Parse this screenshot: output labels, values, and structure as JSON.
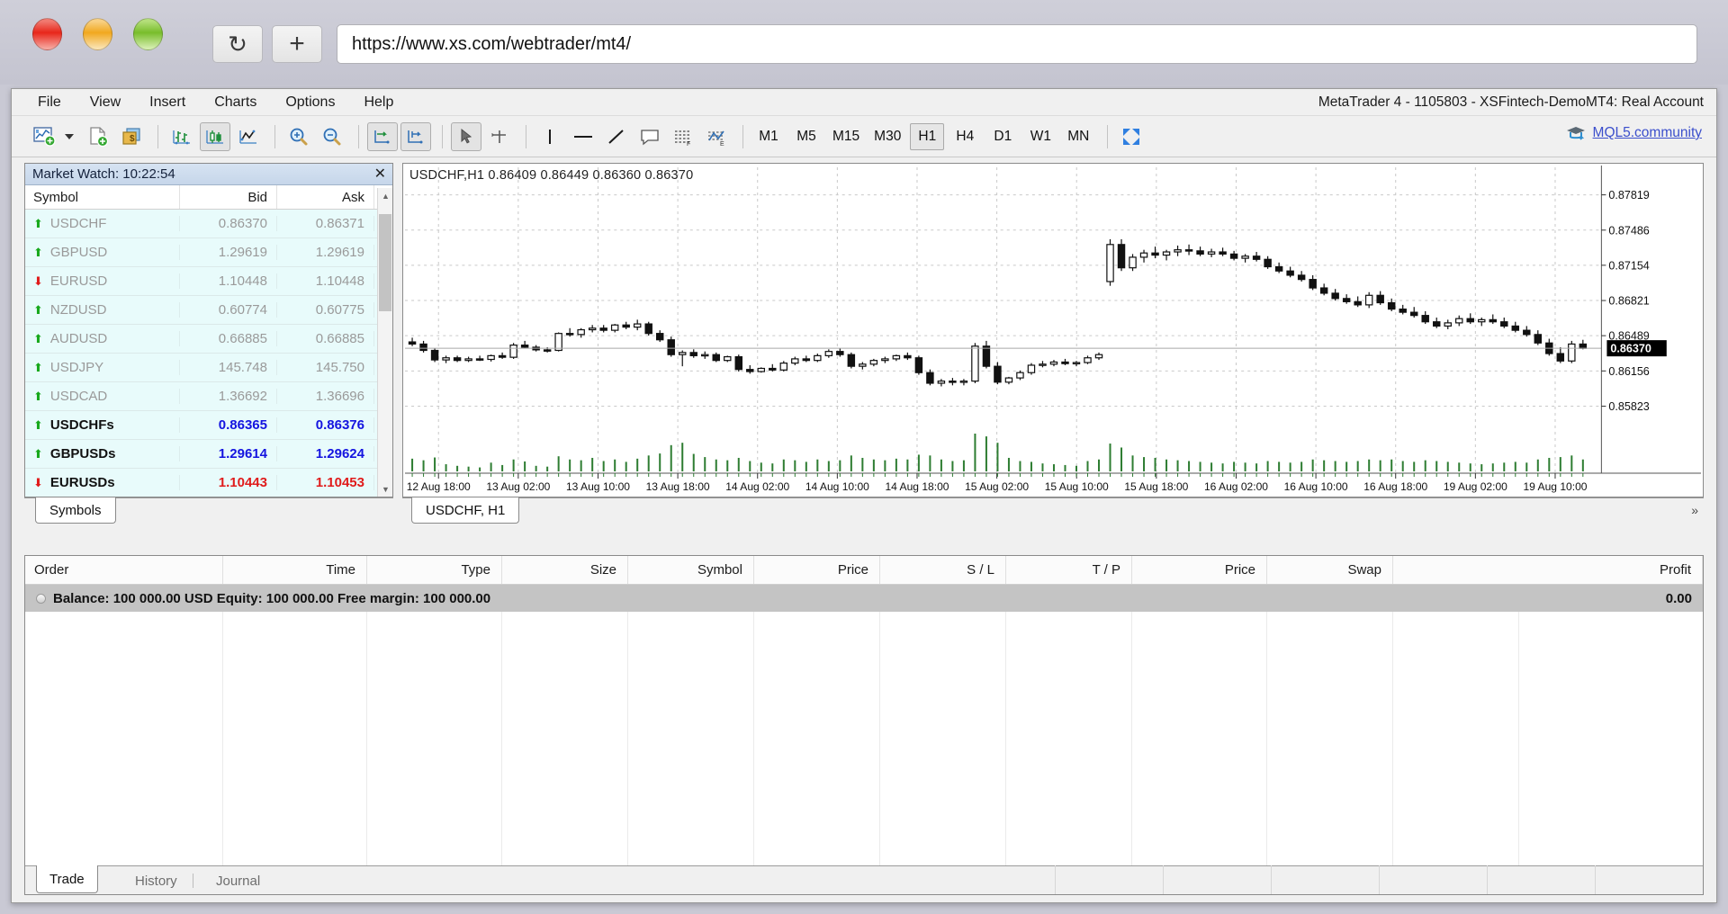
{
  "browser": {
    "url": "https://www.xs.com/webtrader/mt4/",
    "reload_icon": "reload-icon",
    "newtab_icon": "plus-icon",
    "traffic_lights": [
      "close",
      "minimize",
      "maximize"
    ]
  },
  "app": {
    "account_info": "MetaTrader 4 - 1105803 - XSFintech-DemoMT4: Real Account",
    "menu": [
      "File",
      "View",
      "Insert",
      "Charts",
      "Options",
      "Help"
    ],
    "mql5_link": "MQL5.community"
  },
  "toolbar": {
    "timeframes": [
      {
        "label": "M1",
        "active": false
      },
      {
        "label": "M5",
        "active": false
      },
      {
        "label": "M15",
        "active": false
      },
      {
        "label": "M30",
        "active": false
      },
      {
        "label": "H1",
        "active": true
      },
      {
        "label": "H4",
        "active": false
      },
      {
        "label": "D1",
        "active": false
      },
      {
        "label": "W1",
        "active": false
      },
      {
        "label": "MN",
        "active": false
      }
    ],
    "icons": [
      "new-chart-icon",
      "new-order-icon",
      "accounts-icon",
      "bar-chart-icon",
      "candlestick-chart-icon",
      "line-chart-icon",
      "zoom-in-icon",
      "zoom-out-icon",
      "auto-scroll-icon",
      "chart-shift-icon",
      "cursor-icon",
      "crosshair-icon",
      "vertical-line-icon",
      "horizontal-line-icon",
      "trendline-icon",
      "text-label-icon",
      "fibonacci-icon",
      "indicators-icon",
      "fullscreen-icon"
    ]
  },
  "market_watch": {
    "title": "Market Watch: 10:22:54",
    "close_icon": "close-icon",
    "columns": [
      "Symbol",
      "Bid",
      "Ask"
    ],
    "tab": "Symbols",
    "rows": [
      {
        "dir": "up",
        "symbol": "USDCHF",
        "bid": "0.86370",
        "ask": "0.86371",
        "style": "dim"
      },
      {
        "dir": "up",
        "symbol": "GBPUSD",
        "bid": "1.29619",
        "ask": "1.29619",
        "style": "dim"
      },
      {
        "dir": "down",
        "symbol": "EURUSD",
        "bid": "1.10448",
        "ask": "1.10448",
        "style": "dim"
      },
      {
        "dir": "up",
        "symbol": "NZDUSD",
        "bid": "0.60774",
        "ask": "0.60775",
        "style": "dim"
      },
      {
        "dir": "up",
        "symbol": "AUDUSD",
        "bid": "0.66885",
        "ask": "0.66885",
        "style": "dim"
      },
      {
        "dir": "up",
        "symbol": "USDJPY",
        "bid": "145.748",
        "ask": "145.750",
        "style": "dim"
      },
      {
        "dir": "up",
        "symbol": "USDCAD",
        "bid": "1.36692",
        "ask": "1.36696",
        "style": "dim"
      },
      {
        "dir": "up",
        "symbol": "USDCHFs",
        "bid": "0.86365",
        "ask": "0.86376",
        "style": "blue"
      },
      {
        "dir": "up",
        "symbol": "GBPUSDs",
        "bid": "1.29614",
        "ask": "1.29624",
        "style": "blue"
      },
      {
        "dir": "down",
        "symbol": "EURUSDs",
        "bid": "1.10443",
        "ask": "1.10453",
        "style": "red"
      }
    ]
  },
  "chart": {
    "header": "USDCHF,H1  0.86409 0.86449 0.86360 0.86370",
    "tab_label": "USDCHF, H1",
    "more_icon": "chevron-right-icon",
    "current_price": "0.86370"
  },
  "terminal": {
    "columns": [
      "Order",
      "Time",
      "Type",
      "Size",
      "Symbol",
      "Price",
      "S / L",
      "T / P",
      "Price",
      "Swap",
      "Profit"
    ],
    "balance_line": "Balance: 100 000.00 USD  Equity: 100 000.00  Free margin: 100 000.00",
    "profit_value": "0.00",
    "tabs": [
      {
        "label": "Trade",
        "active": true
      },
      {
        "label": "History",
        "active": false
      },
      {
        "label": "Journal",
        "active": false
      }
    ]
  },
  "chart_data": {
    "type": "candlestick",
    "title": "USDCHF,H1",
    "symbol": "USDCHF",
    "timeframe": "H1",
    "ohlc_last": {
      "open": "0.86409",
      "high": "0.86449",
      "low": "0.86360",
      "close": "0.86370"
    },
    "y_ticks": [
      "0.87819",
      "0.87486",
      "0.87154",
      "0.86821",
      "0.86489",
      "0.86156",
      "0.85823"
    ],
    "ylim": [
      0.857,
      0.8796
    ],
    "price_line": 0.8637,
    "x_ticks": [
      "12 Aug 18:00",
      "13 Aug 02:00",
      "13 Aug 10:00",
      "13 Aug 18:00",
      "14 Aug 02:00",
      "14 Aug 10:00",
      "14 Aug 18:00",
      "15 Aug 02:00",
      "15 Aug 10:00",
      "15 Aug 18:00",
      "16 Aug 02:00",
      "16 Aug 10:00",
      "16 Aug 18:00",
      "19 Aug 02:00",
      "19 Aug 10:00"
    ],
    "grid": true,
    "volume_color": "#2e7d32",
    "candles": [
      [
        0.8643,
        0.8647,
        0.8639,
        0.8641,
        32
      ],
      [
        0.8641,
        0.8644,
        0.8633,
        0.8635,
        28
      ],
      [
        0.8635,
        0.8637,
        0.8624,
        0.8626,
        35
      ],
      [
        0.8626,
        0.863,
        0.8623,
        0.8628,
        18
      ],
      [
        0.8628,
        0.863,
        0.8624,
        0.86255,
        14
      ],
      [
        0.86255,
        0.8629,
        0.8624,
        0.8627,
        12
      ],
      [
        0.8627,
        0.863,
        0.8625,
        0.86265,
        10
      ],
      [
        0.86265,
        0.8631,
        0.86245,
        0.863,
        22
      ],
      [
        0.863,
        0.8633,
        0.8627,
        0.86285,
        16
      ],
      [
        0.86285,
        0.8642,
        0.8627,
        0.864,
        30
      ],
      [
        0.864,
        0.8644,
        0.8637,
        0.8638,
        25
      ],
      [
        0.8638,
        0.864,
        0.8634,
        0.86355,
        14
      ],
      [
        0.86355,
        0.8638,
        0.8633,
        0.8635,
        12
      ],
      [
        0.8635,
        0.8652,
        0.8634,
        0.8651,
        38
      ],
      [
        0.8651,
        0.8656,
        0.8648,
        0.865,
        30
      ],
      [
        0.865,
        0.8656,
        0.8647,
        0.86545,
        28
      ],
      [
        0.86545,
        0.8659,
        0.8652,
        0.8656,
        34
      ],
      [
        0.8656,
        0.8659,
        0.8652,
        0.8654,
        26
      ],
      [
        0.8654,
        0.866,
        0.8652,
        0.8659,
        30
      ],
      [
        0.8659,
        0.8662,
        0.8655,
        0.8657,
        24
      ],
      [
        0.8657,
        0.8664,
        0.8654,
        0.866,
        32
      ],
      [
        0.866,
        0.8662,
        0.8649,
        0.8651,
        40
      ],
      [
        0.8651,
        0.8654,
        0.8643,
        0.8645,
        45
      ],
      [
        0.8645,
        0.8648,
        0.8629,
        0.8631,
        66
      ],
      [
        0.8631,
        0.8635,
        0.862,
        0.8633,
        72
      ],
      [
        0.8633,
        0.8636,
        0.8628,
        0.863,
        44
      ],
      [
        0.863,
        0.8634,
        0.8627,
        0.8631,
        36
      ],
      [
        0.8631,
        0.8633,
        0.8624,
        0.86255,
        30
      ],
      [
        0.86255,
        0.863,
        0.8624,
        0.8629,
        28
      ],
      [
        0.8629,
        0.8631,
        0.8615,
        0.8617,
        34
      ],
      [
        0.8617,
        0.8621,
        0.8613,
        0.8615,
        26
      ],
      [
        0.8615,
        0.8619,
        0.8614,
        0.8618,
        22
      ],
      [
        0.8618,
        0.8622,
        0.8615,
        0.86165,
        20
      ],
      [
        0.86165,
        0.8625,
        0.8615,
        0.8623,
        30
      ],
      [
        0.8623,
        0.8629,
        0.8621,
        0.8627,
        28
      ],
      [
        0.8627,
        0.863,
        0.8624,
        0.86255,
        24
      ],
      [
        0.86255,
        0.8632,
        0.8624,
        0.863,
        30
      ],
      [
        0.863,
        0.8636,
        0.8628,
        0.8634,
        26
      ],
      [
        0.8634,
        0.8637,
        0.8629,
        0.8631,
        28
      ],
      [
        0.8631,
        0.8633,
        0.8618,
        0.862,
        40
      ],
      [
        0.862,
        0.8624,
        0.8617,
        0.8622,
        34
      ],
      [
        0.8622,
        0.8627,
        0.862,
        0.86255,
        30
      ],
      [
        0.86255,
        0.8629,
        0.8623,
        0.8627,
        28
      ],
      [
        0.8627,
        0.8631,
        0.8625,
        0.863,
        32
      ],
      [
        0.863,
        0.8633,
        0.8626,
        0.8628,
        30
      ],
      [
        0.8628,
        0.863,
        0.8612,
        0.8614,
        42
      ],
      [
        0.8614,
        0.8617,
        0.8602,
        0.8604,
        40
      ],
      [
        0.8604,
        0.8608,
        0.8601,
        0.8606,
        30
      ],
      [
        0.8606,
        0.8609,
        0.8602,
        0.8605,
        26
      ],
      [
        0.8605,
        0.8608,
        0.8602,
        0.8606,
        28
      ],
      [
        0.8606,
        0.8642,
        0.8604,
        0.8639,
        95
      ],
      [
        0.8639,
        0.8644,
        0.8618,
        0.862,
        88
      ],
      [
        0.862,
        0.8624,
        0.8603,
        0.8605,
        72
      ],
      [
        0.8605,
        0.861,
        0.8603,
        0.8609,
        34
      ],
      [
        0.8609,
        0.8616,
        0.8607,
        0.8614,
        26
      ],
      [
        0.8614,
        0.8623,
        0.8612,
        0.8621,
        24
      ],
      [
        0.8621,
        0.8625,
        0.8619,
        0.8622,
        20
      ],
      [
        0.8622,
        0.8626,
        0.862,
        0.8624,
        18
      ],
      [
        0.8624,
        0.8627,
        0.8621,
        0.86225,
        16
      ],
      [
        0.86225,
        0.8625,
        0.862,
        0.86235,
        14
      ],
      [
        0.86235,
        0.863,
        0.8622,
        0.8628,
        26
      ],
      [
        0.8628,
        0.8633,
        0.8626,
        0.8631,
        30
      ],
      [
        0.87,
        0.874,
        0.8696,
        0.8735,
        70
      ],
      [
        0.8735,
        0.874,
        0.871,
        0.8713,
        60
      ],
      [
        0.8713,
        0.8726,
        0.871,
        0.8723,
        40
      ],
      [
        0.8723,
        0.873,
        0.8718,
        0.8727,
        36
      ],
      [
        0.8727,
        0.8733,
        0.8722,
        0.8725,
        34
      ],
      [
        0.8725,
        0.873,
        0.872,
        0.8728,
        30
      ],
      [
        0.8728,
        0.8734,
        0.8724,
        0.873,
        28
      ],
      [
        0.873,
        0.8735,
        0.8725,
        0.8729,
        26
      ],
      [
        0.8729,
        0.8733,
        0.8724,
        0.8726,
        24
      ],
      [
        0.8726,
        0.8731,
        0.8723,
        0.8728,
        22
      ],
      [
        0.8728,
        0.8732,
        0.8724,
        0.8726,
        20
      ],
      [
        0.8726,
        0.8729,
        0.872,
        0.8722,
        24
      ],
      [
        0.8722,
        0.8726,
        0.8718,
        0.8724,
        22
      ],
      [
        0.8724,
        0.8728,
        0.8719,
        0.8721,
        20
      ],
      [
        0.8721,
        0.8724,
        0.8712,
        0.8714,
        26
      ],
      [
        0.8714,
        0.8718,
        0.8708,
        0.871,
        24
      ],
      [
        0.871,
        0.8714,
        0.8704,
        0.8706,
        22
      ],
      [
        0.8706,
        0.871,
        0.87,
        0.8702,
        24
      ],
      [
        0.8702,
        0.8706,
        0.8692,
        0.8694,
        30
      ],
      [
        0.8694,
        0.8698,
        0.8687,
        0.8689,
        28
      ],
      [
        0.8689,
        0.8693,
        0.8682,
        0.8684,
        26
      ],
      [
        0.8684,
        0.8688,
        0.8679,
        0.8681,
        24
      ],
      [
        0.8681,
        0.8686,
        0.8676,
        0.8678,
        26
      ],
      [
        0.8678,
        0.869,
        0.8675,
        0.8687,
        30
      ],
      [
        0.8687,
        0.8691,
        0.8678,
        0.868,
        28
      ],
      [
        0.868,
        0.8684,
        0.8672,
        0.8674,
        30
      ],
      [
        0.8674,
        0.8678,
        0.8669,
        0.8671,
        26
      ],
      [
        0.8671,
        0.8676,
        0.8666,
        0.8668,
        24
      ],
      [
        0.8668,
        0.8672,
        0.866,
        0.8662,
        28
      ],
      [
        0.8662,
        0.8666,
        0.8656,
        0.8658,
        26
      ],
      [
        0.8658,
        0.8664,
        0.8655,
        0.8661,
        24
      ],
      [
        0.8661,
        0.8668,
        0.8658,
        0.8665,
        22
      ],
      [
        0.8665,
        0.867,
        0.866,
        0.8662,
        20
      ],
      [
        0.8662,
        0.8666,
        0.8658,
        0.8664,
        18
      ],
      [
        0.8664,
        0.8669,
        0.866,
        0.8662,
        20
      ],
      [
        0.8662,
        0.8666,
        0.8656,
        0.8658,
        22
      ],
      [
        0.8658,
        0.8662,
        0.8652,
        0.8654,
        24
      ],
      [
        0.8654,
        0.8658,
        0.8648,
        0.865,
        22
      ],
      [
        0.865,
        0.8654,
        0.864,
        0.8642,
        30
      ],
      [
        0.8642,
        0.8646,
        0.863,
        0.8632,
        34
      ],
      [
        0.8632,
        0.8638,
        0.8623,
        0.8625,
        36
      ],
      [
        0.8625,
        0.8644,
        0.8623,
        0.8641,
        40
      ],
      [
        0.8641,
        0.8645,
        0.8636,
        0.8637,
        30
      ]
    ]
  }
}
